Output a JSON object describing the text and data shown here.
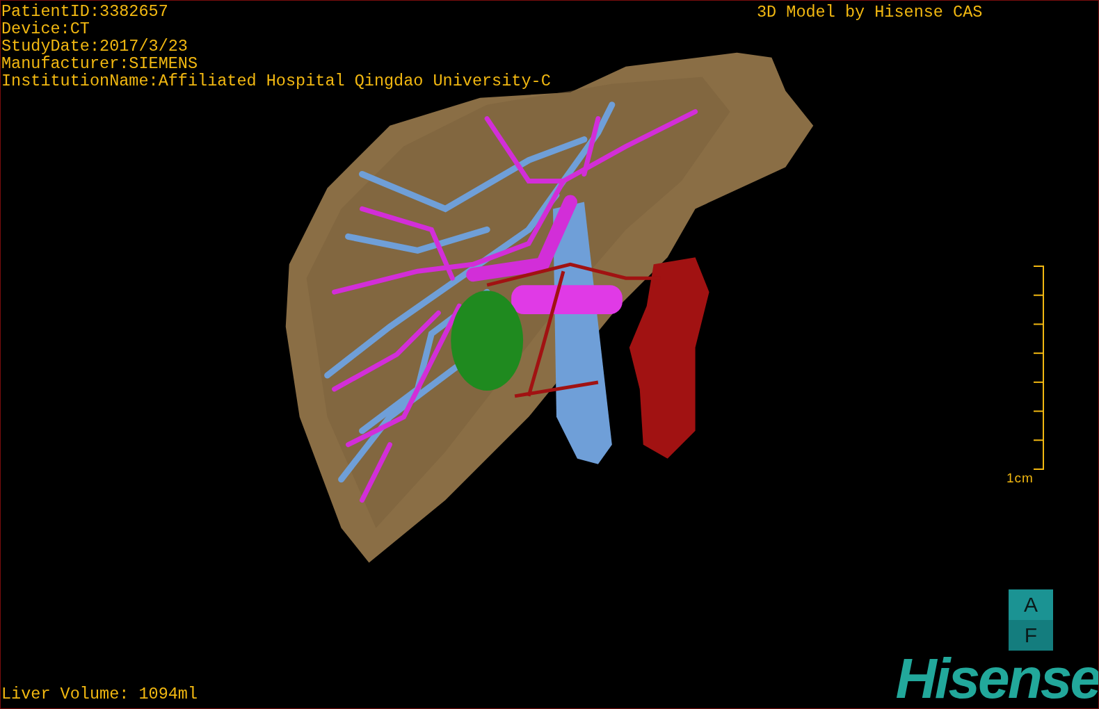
{
  "patient_info": [
    "PatientID:3382657",
    "Device:CT",
    "StudyDate:2017/3/23",
    "Manufacturer:SIEMENS",
    "InstitutionName:Affiliated Hospital Qingdao University-C"
  ],
  "title": "3D Model by Hisense CAS",
  "scale_bar": {
    "label": "1cm"
  },
  "orientation_cube": {
    "top": "A",
    "bottom": "F"
  },
  "logo": "Hisense",
  "liver_volume": "Liver Volume: 1094ml"
}
